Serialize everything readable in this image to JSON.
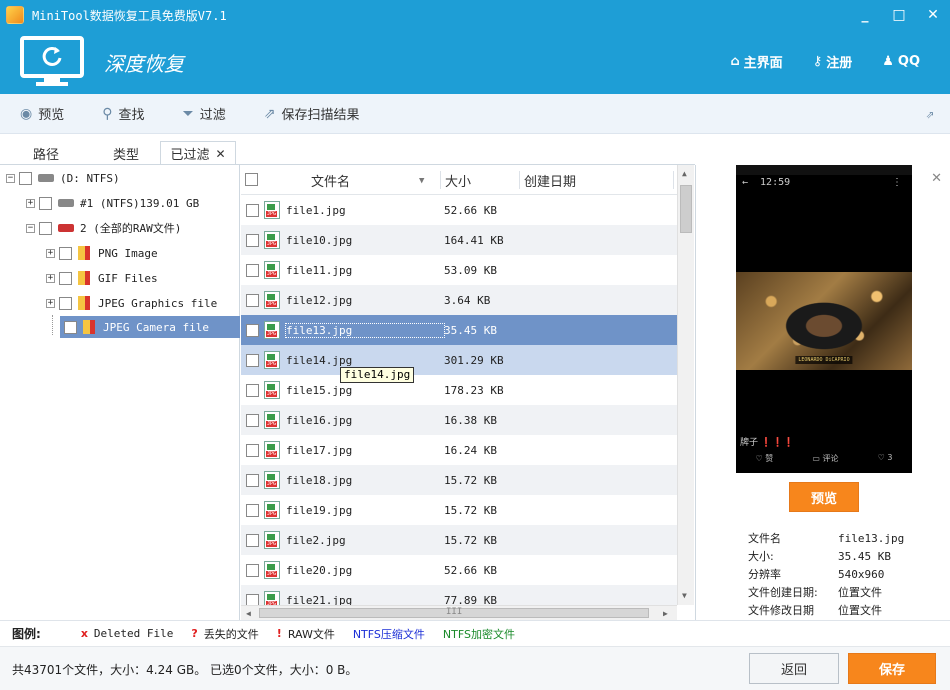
{
  "window": {
    "title": "MiniTool数据恢复工具免费版V7.1",
    "minimize": "_",
    "maximize": "□",
    "close": "✕"
  },
  "header": {
    "product": "深度恢复",
    "nav": [
      {
        "label": "主界面",
        "icon": "home-icon"
      },
      {
        "label": "注册",
        "icon": "key-icon"
      },
      {
        "label": "QQ",
        "icon": "qq-icon"
      }
    ]
  },
  "toolbar": {
    "preview": "预览",
    "find": "查找",
    "filter": "过滤",
    "save_scan": "保存扫描结果"
  },
  "tabs": {
    "path": "路径",
    "type": "类型",
    "filtered": "已过滤"
  },
  "tree": [
    {
      "label": "(D: NTFS)",
      "level": 0
    },
    {
      "label": "#1 (NTFS)139.01 GB",
      "level": 1
    },
    {
      "label": "2 (全部的RAW文件)",
      "level": 1
    },
    {
      "label": "PNG Image",
      "level": 2
    },
    {
      "label": "GIF Files",
      "level": 2
    },
    {
      "label": "JPEG Graphics file",
      "level": 2
    },
    {
      "label": "JPEG Camera file",
      "level": 2
    }
  ],
  "list": {
    "col_name": "文件名",
    "col_size": "大小",
    "col_date": "创建日期",
    "rows": [
      {
        "name": "file1.jpg",
        "size": "52.66 KB"
      },
      {
        "name": "file10.jpg",
        "size": "164.41 KB"
      },
      {
        "name": "file11.jpg",
        "size": "53.09 KB"
      },
      {
        "name": "file12.jpg",
        "size": "3.64 KB"
      },
      {
        "name": "file13.jpg",
        "size": "35.45 KB"
      },
      {
        "name": "file14.jpg",
        "size": "301.29 KB"
      },
      {
        "name": "file15.jpg",
        "size": "178.23 KB"
      },
      {
        "name": "file16.jpg",
        "size": "16.38 KB"
      },
      {
        "name": "file17.jpg",
        "size": "16.24 KB"
      },
      {
        "name": "file18.jpg",
        "size": "15.72 KB"
      },
      {
        "name": "file19.jpg",
        "size": "15.72 KB"
      },
      {
        "name": "file2.jpg",
        "size": "15.72 KB"
      },
      {
        "name": "file20.jpg",
        "size": "52.66 KB"
      },
      {
        "name": "file21.jpg",
        "size": "77.89 KB"
      }
    ],
    "tooltip": "file14.jpg",
    "hscroll_grip": "III"
  },
  "preview": {
    "phone_time": "12:59",
    "caption": "LEONARDO DiCAPRIO",
    "bottom_text": "牌子 ❗❗❗",
    "action_like": "赞",
    "action_comment": "评论",
    "action_count": "3",
    "button": "预览",
    "info": [
      {
        "k": "文件名",
        "v": "file13.jpg"
      },
      {
        "k": "大小:",
        "v": "35.45 KB"
      },
      {
        "k": "分辨率",
        "v": "540x960"
      },
      {
        "k": "文件创建日期:",
        "v": "位置文件"
      },
      {
        "k": "文件修改日期",
        "v": "位置文件"
      }
    ]
  },
  "legend": {
    "label": "图例:",
    "deleted": "Deleted File",
    "lost": "丢失的文件",
    "raw": "RAW文件",
    "ntfs_comp": "NTFS压缩文件",
    "ntfs_enc": "NTFS加密文件",
    "colors": {
      "mark": "#e02020",
      "comp": "#1c2fd6",
      "enc": "#1a8a2a"
    }
  },
  "footer": {
    "summary": "共43701个文件，大小：4.24 GB。 已选0个文件，大小：0 B。",
    "back": "返回",
    "save": "保存"
  },
  "colors": {
    "accent": "#1e9ed6",
    "orange": "#f7861c",
    "selection": "#6f93c8"
  }
}
